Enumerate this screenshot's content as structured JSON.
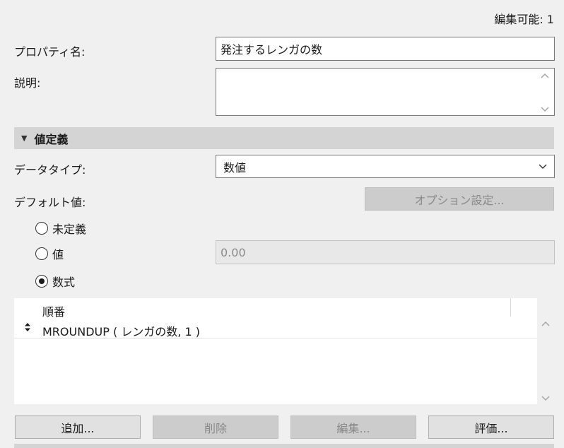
{
  "header": {
    "editable_count": "編集可能: 1"
  },
  "property_name": {
    "label": "プロパティ名:",
    "value": "発注するレンガの数"
  },
  "description": {
    "label": "説明:",
    "value": ""
  },
  "value_definition": {
    "title": "値定義"
  },
  "data_type": {
    "label": "データタイプ:",
    "selected": "数値"
  },
  "default_value": {
    "label": "デフォルト値:",
    "options_button": "オプション設定...",
    "radio_undefined": "未定義",
    "radio_value": "値",
    "value_field": "0.00",
    "radio_formula": "数式",
    "selected_radio": "formula"
  },
  "order_table": {
    "header": "順番",
    "rows": [
      {
        "expression": "MROUNDUP ( レンガの数, 1 )"
      }
    ]
  },
  "buttons": {
    "add": "追加...",
    "delete": "削除",
    "edit": "編集...",
    "evaluate": "評価..."
  },
  "colors": {
    "background": "#f0f0f0",
    "section_header": "#d4d4d4",
    "disabled_button": "#cccccc"
  },
  "icons": {
    "scroll_up": "chevron-up-icon",
    "scroll_down": "chevron-down-icon",
    "dropdown": "chevron-down-icon",
    "collapse": "triangle-down-icon",
    "sort_handle": "up-down-arrow-icon"
  }
}
